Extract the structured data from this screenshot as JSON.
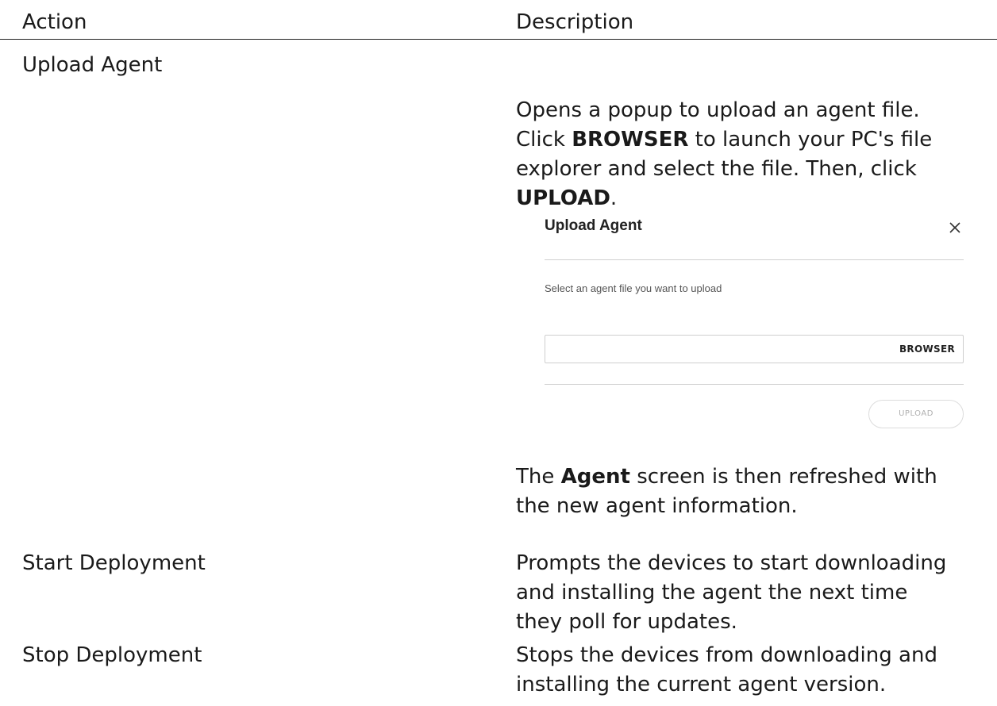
{
  "header": {
    "action": "Action",
    "description": "Description"
  },
  "rows": [
    {
      "action": "Upload Agent",
      "desc_l1_a": "Opens a popup to upload an agent file.",
      "desc_l2_a": "Click ",
      "desc_l2_b": "BROWSER",
      "desc_l2_c": " to launch your PC's file",
      "desc_l3_a": "explorer and select the file. Then, click",
      "desc_l4_b": "UPLOAD",
      "desc_l4_c": ".",
      "after_l1_a": "The ",
      "after_l1_b": "Agent",
      "after_l1_c": " screen is then refreshed with",
      "after_l2": "the new agent information."
    },
    {
      "action": "Start Deployment",
      "desc_l1": "Prompts the devices to start downloading",
      "desc_l2": "and installing the agent the next time",
      "desc_l3": "they poll for updates."
    },
    {
      "action": "Stop Deployment",
      "desc_l1": "Stops the devices from downloading and",
      "desc_l2": "installing the current agent version."
    }
  ],
  "modal": {
    "title": "Upload Agent",
    "close_icon": "close-icon",
    "prompt": "Select an agent file you want to upload",
    "file_value": "",
    "browse_label": "BROWSER",
    "upload_label": "UPLOAD"
  }
}
